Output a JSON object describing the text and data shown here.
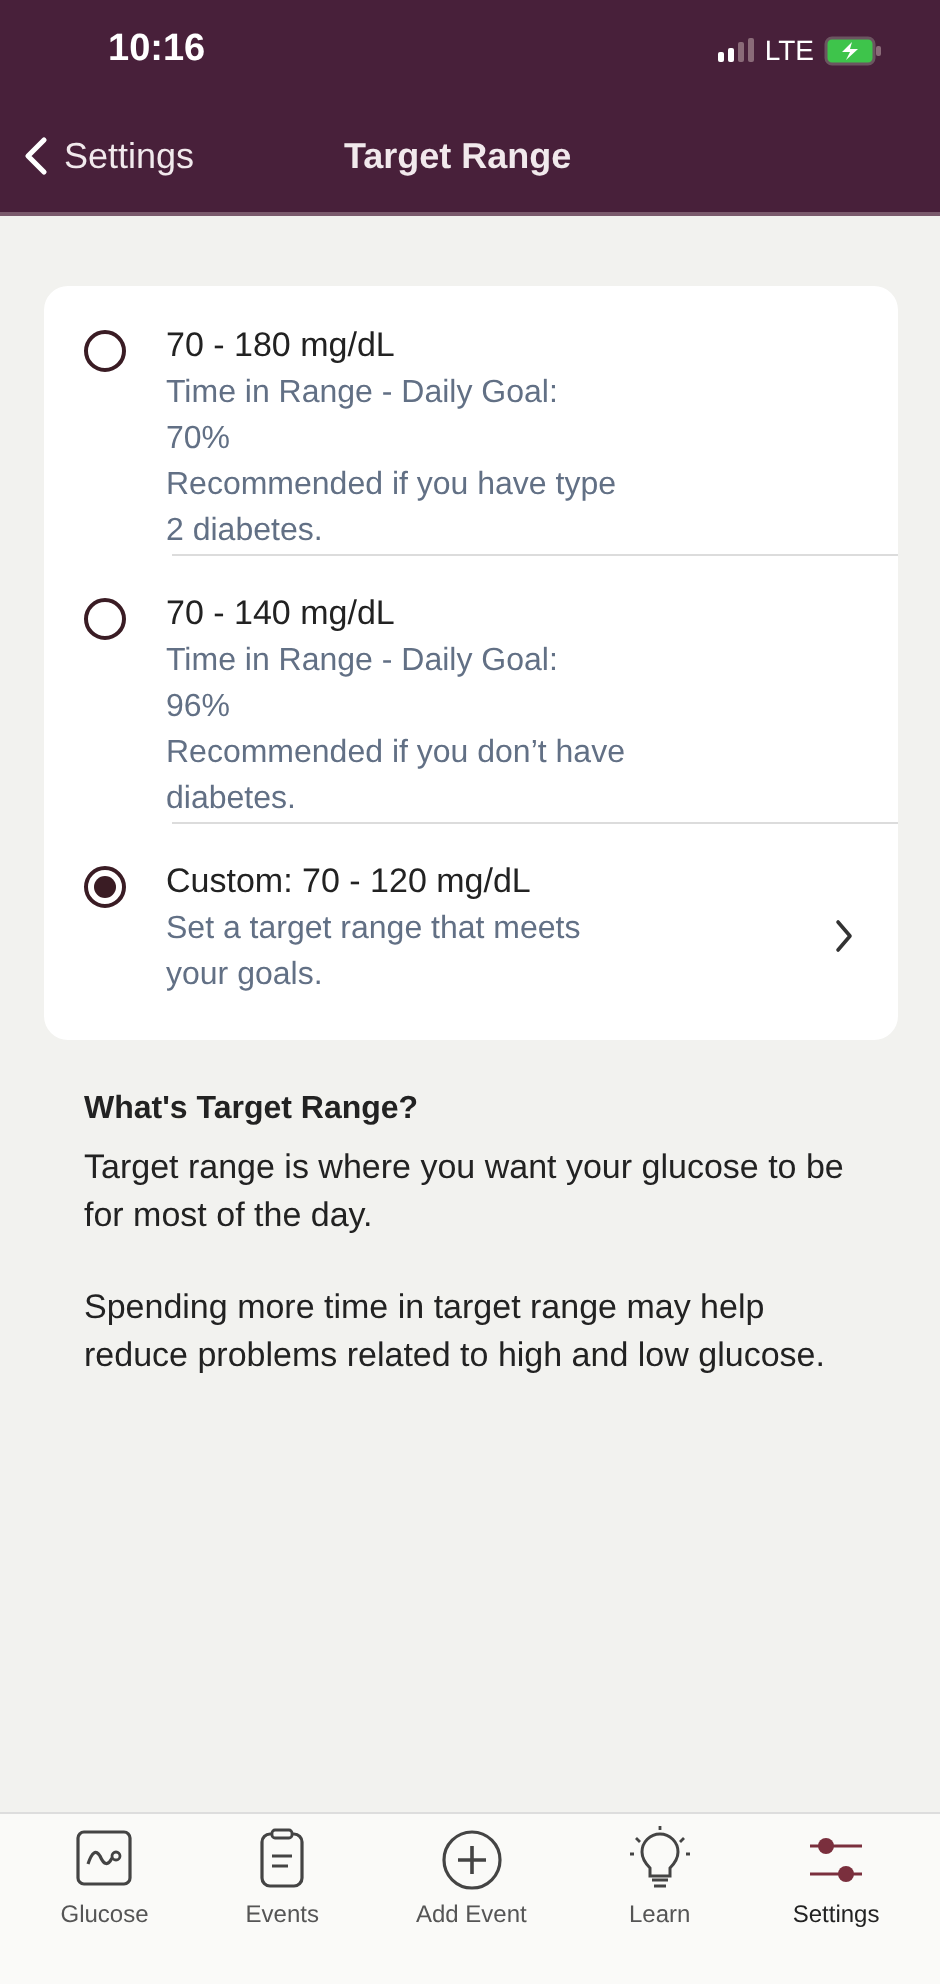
{
  "status_bar": {
    "time": "10:16",
    "network": "LTE"
  },
  "nav": {
    "back_label": "Settings",
    "title": "Target Range"
  },
  "options": [
    {
      "title": "70 - 180 mg/dL",
      "lines": [
        "Time in Range - Daily Goal: 70%",
        "Recommended if you have type 2 diabetes."
      ],
      "selected": false,
      "chevron": false
    },
    {
      "title": "70 - 140 mg/dL",
      "lines": [
        "Time in Range - Daily Goal: 96%",
        "Recommended if you don’t have diabetes."
      ],
      "selected": false,
      "chevron": false
    },
    {
      "title": "Custom: 70 - 120 mg/dL",
      "lines": [
        "Set a target range that meets your goals."
      ],
      "selected": true,
      "chevron": true
    }
  ],
  "info": {
    "heading": "What's Target Range?",
    "paragraphs": [
      "Target range is where you want your glucose to be for most of the day.",
      "Spending more time in target range may help reduce problems related to high and low glucose."
    ]
  },
  "tabs": [
    {
      "kind": "glucose",
      "label": "Glucose",
      "selected": false
    },
    {
      "kind": "events",
      "label": "Events",
      "selected": false
    },
    {
      "kind": "add",
      "label": "Add Event",
      "selected": false
    },
    {
      "kind": "learn",
      "label": "Learn",
      "selected": false
    },
    {
      "kind": "settings",
      "label": "Settings",
      "selected": true
    }
  ]
}
